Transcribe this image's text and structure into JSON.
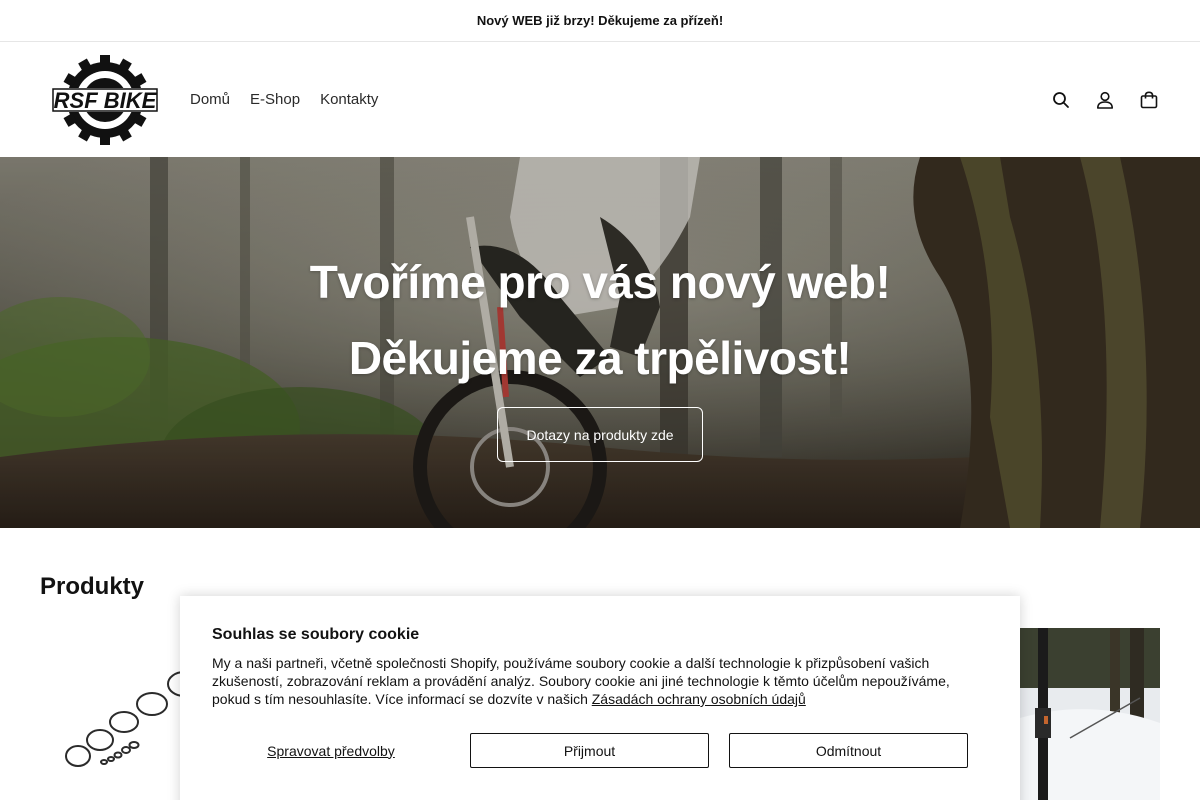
{
  "announcement": {
    "text": "Nový WEB již brzy! Děkujeme za přízeň!"
  },
  "header": {
    "logo_text": "RSF BIKE",
    "nav": [
      {
        "label": "Domů"
      },
      {
        "label": "E-Shop"
      },
      {
        "label": "Kontakty"
      }
    ],
    "icons": [
      "search-icon",
      "account-icon",
      "cart-icon"
    ]
  },
  "hero": {
    "title_line1": "Tvoříme pro vás nový web!",
    "title_line2": "Děkujeme za trpělivost!",
    "button_label": "Dotazy na produkty zde"
  },
  "products": {
    "title": "Produkty"
  },
  "cookie_banner": {
    "title": "Souhlas se soubory cookie",
    "text": "My a naši partneři, včetně společnosti Shopify, používáme soubory cookie a další technologie k přizpůsobení vašich zkušeností, zobrazování reklam a provádění analýz. Soubory cookie ani jiné technologie k těmto účelům nepoužíváme, pokud s tím nesouhlasíte. Více informací se dozvíte v našich",
    "link_text": "Zásadách ochrany osobních údajů",
    "manage_label": "Spravovat předvolby",
    "accept_label": "Přijmout",
    "decline_label": "Odmítnout"
  },
  "colors": {
    "text": "#121212",
    "background": "#ffffff",
    "hero_overlay": "#2b2a24"
  }
}
